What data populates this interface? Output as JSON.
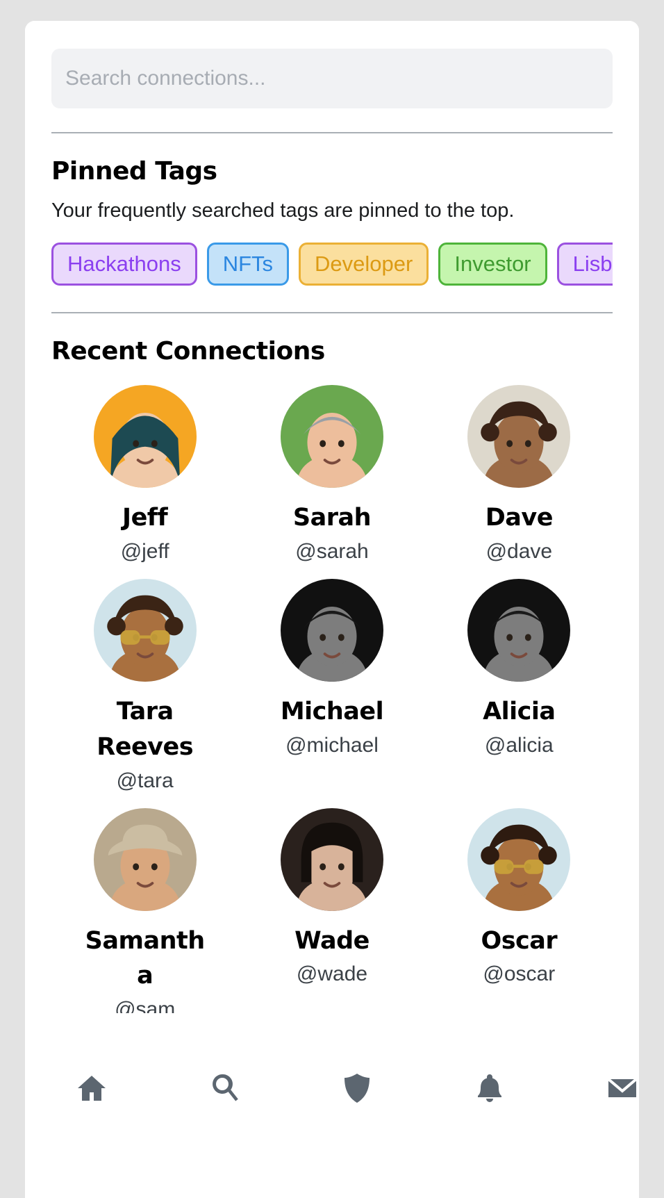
{
  "search": {
    "placeholder": "Search connections...",
    "value": "",
    "icon": "search-icon"
  },
  "pinned_tags": {
    "title": "Pinned Tags",
    "description": "Your frequently searched tags are pinned to the top.",
    "tags": [
      {
        "label": "Hackathons",
        "text_color": "#8b3ff0",
        "bg_color": "#ead9fc",
        "border_color": "#9b51e0"
      },
      {
        "label": "NFTs",
        "text_color": "#2b86e0",
        "bg_color": "#c4e2f9",
        "border_color": "#3a9ae8"
      },
      {
        "label": "Developer",
        "text_color": "#dc9a13",
        "bg_color": "#fbdf9e",
        "border_color": "#ebb035"
      },
      {
        "label": "Investor",
        "text_color": "#3f9b30",
        "bg_color": "#c5f5ae",
        "border_color": "#4eb43a"
      },
      {
        "label": "Lisbon",
        "text_color": "#8b3ff0",
        "bg_color": "#ead9fc",
        "border_color": "#9b51e0"
      }
    ]
  },
  "recent_connections": {
    "title": "Recent Connections",
    "people": [
      {
        "name": "Jeff",
        "handle": "@jeff",
        "avatar": "avatar-jeff"
      },
      {
        "name": "Sarah",
        "handle": "@sarah",
        "avatar": "avatar-sarah"
      },
      {
        "name": "Dave",
        "handle": "@dave",
        "avatar": "avatar-dave"
      },
      {
        "name": "Tara Reeves",
        "handle": "@tara",
        "avatar": "avatar-tara"
      },
      {
        "name": "Michael",
        "handle": "@michael",
        "avatar": "avatar-michael"
      },
      {
        "name": "Alicia",
        "handle": "@alicia",
        "avatar": "avatar-alicia"
      },
      {
        "name": "Samantha",
        "handle": "@sam",
        "avatar": "avatar-samantha"
      },
      {
        "name": "Wade",
        "handle": "@wade",
        "avatar": "avatar-wade"
      },
      {
        "name": "Oscar",
        "handle": "@oscar",
        "avatar": "avatar-oscar"
      }
    ]
  },
  "bottom_nav": {
    "items": [
      {
        "icon": "home-icon",
        "label": "Home"
      },
      {
        "icon": "search-icon",
        "label": "Search"
      },
      {
        "icon": "shield-icon",
        "label": "Shield"
      },
      {
        "icon": "bell-icon",
        "label": "Notifications"
      },
      {
        "icon": "envelope-icon",
        "label": "Messages"
      }
    ],
    "icon_color": "#5c6670"
  },
  "colors": {
    "page_background": "#e3e3e3",
    "card_background": "#ffffff",
    "divider": "#a9afb5",
    "search_background": "#f1f2f4",
    "placeholder": "#a7acb3"
  }
}
